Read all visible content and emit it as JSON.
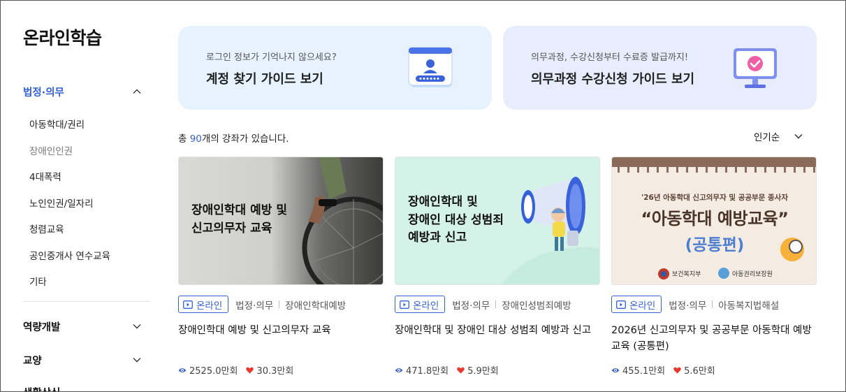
{
  "sidebar": {
    "title": "온라인학습",
    "categories": [
      {
        "label": "법정·의무",
        "expanded": true
      },
      {
        "label": "역량개발",
        "expanded": false
      },
      {
        "label": "교양",
        "expanded": false
      },
      {
        "label": "생활상식",
        "expanded": false
      }
    ],
    "subitems": [
      "아동학대/권리",
      "장애인인권",
      "4대폭력",
      "노인인권/일자리",
      "청렴교육",
      "공인중개사 연수교육",
      "기타"
    ]
  },
  "banners": [
    {
      "subtitle": "로그인 정보가 기억나지 않으세요?",
      "title": "계정 찾기 가이드 보기",
      "icon": "login-id-icon"
    },
    {
      "subtitle": "의무과정, 수강신청부터 수료증 발급까지!",
      "title": "의무과정 수강신청 가이드 보기",
      "icon": "monitor-check-icon"
    }
  ],
  "summary": {
    "prefix": "총 ",
    "count": "90",
    "suffix": "개의 강좌가 있습니다."
  },
  "sort": {
    "selected": "인기순"
  },
  "courses": [
    {
      "thumb_title": "장애인학대 예방 및\n신고의무자 교육",
      "badge": "온라인",
      "category": "법정·의무",
      "subcategory": "장애인학대예방",
      "title": "장애인학대 예방 및 신고의무자 교육",
      "views": "2525.0만회",
      "likes": "30.3만회"
    },
    {
      "thumb_title": "장애인학대 및\n장애인 대상 성범죄\n예방과 신고",
      "badge": "온라인",
      "category": "법정·의무",
      "subcategory": "장애인성범죄예방",
      "title": "장애인학대 및 장애인 대상 성범죄 예방과 신고",
      "views": "471.8만회",
      "likes": "5.9만회"
    },
    {
      "thumb_small": "'26년 아동학대 신고의무자 및 공공부문 종사자",
      "thumb_title": "“아동학대 예방교육”",
      "thumb_sub": "(공통편)",
      "thumb_org1": "보건복지부",
      "thumb_org2": "아동권리보장원",
      "badge": "온라인",
      "category": "법정·의무",
      "subcategory": "아동복지법해설",
      "title": "2026년 신고의무자 및 공공부문 아동학대 예방교육 (공통편)",
      "views": "455.1만회",
      "likes": "5.6만회"
    }
  ],
  "colors": {
    "accent": "#3461d6",
    "heart": "#e8382f",
    "banner1": "#e6f2fd",
    "banner2": "#e7edfc"
  }
}
